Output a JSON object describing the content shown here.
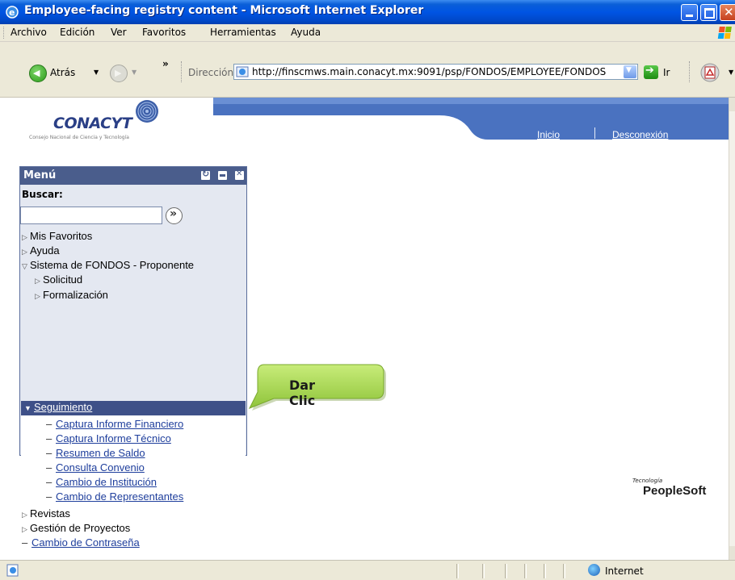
{
  "window": {
    "title": "Employee-facing registry content - Microsoft Internet Explorer"
  },
  "menubar": {
    "items": [
      "Archivo",
      "Edición",
      "Ver",
      "Favoritos",
      "Herramientas",
      "Ayuda"
    ]
  },
  "toolbar": {
    "back_label": "Atrás",
    "address_label": "Dirección",
    "address_url": "http://finscmws.main.conacyt.mx:9091/psp/FONDOS/EMPLOYEE/FONDOS",
    "go_label": "Ir"
  },
  "header": {
    "brand": "CONACYT",
    "brand_subtitle": "Consejo Nacional de Ciencia y Tecnología",
    "links": [
      "Inicio",
      "Desconexión"
    ]
  },
  "menu": {
    "title": "Menú",
    "search_label": "Buscar:",
    "search_value": "",
    "items": [
      {
        "label": "Mis Favoritos",
        "type": "collapsed"
      },
      {
        "label": "Ayuda",
        "type": "collapsed"
      },
      {
        "label": "Sistema de FONDOS - Proponente",
        "type": "expanded"
      },
      {
        "label": "Solicitud",
        "type": "collapsed"
      },
      {
        "label": "Formalización",
        "type": "collapsed"
      },
      {
        "label": "Seguimiento",
        "type": "expanded-selected"
      },
      {
        "label": "Captura Informe Financiero",
        "type": "link"
      },
      {
        "label": "Captura Informe Técnico",
        "type": "link"
      },
      {
        "label": "Resumen de Saldo",
        "type": "link"
      },
      {
        "label": "Consulta Convenio",
        "type": "link"
      },
      {
        "label": "Cambio de Institución",
        "type": "link"
      },
      {
        "label": "Cambio de Representantes",
        "type": "link"
      },
      {
        "label": "Revistas",
        "type": "collapsed"
      },
      {
        "label": "Gestión de Proyectos",
        "type": "collapsed"
      },
      {
        "label": "Cambio de Contraseña",
        "type": "link"
      }
    ]
  },
  "callout": {
    "text": "Dar Clic"
  },
  "footer_logo": {
    "small": "Tecnología",
    "big": "PeopleSoft"
  },
  "statusbar": {
    "zone": "Internet"
  },
  "colors": {
    "titlebar": "#0054e3",
    "menu_header": "#4a5d8c",
    "menu_selected": "#3e5088",
    "header_band": "#3f66b8",
    "callout_fill": "#a9d94a",
    "link": "#1e3e9c"
  }
}
